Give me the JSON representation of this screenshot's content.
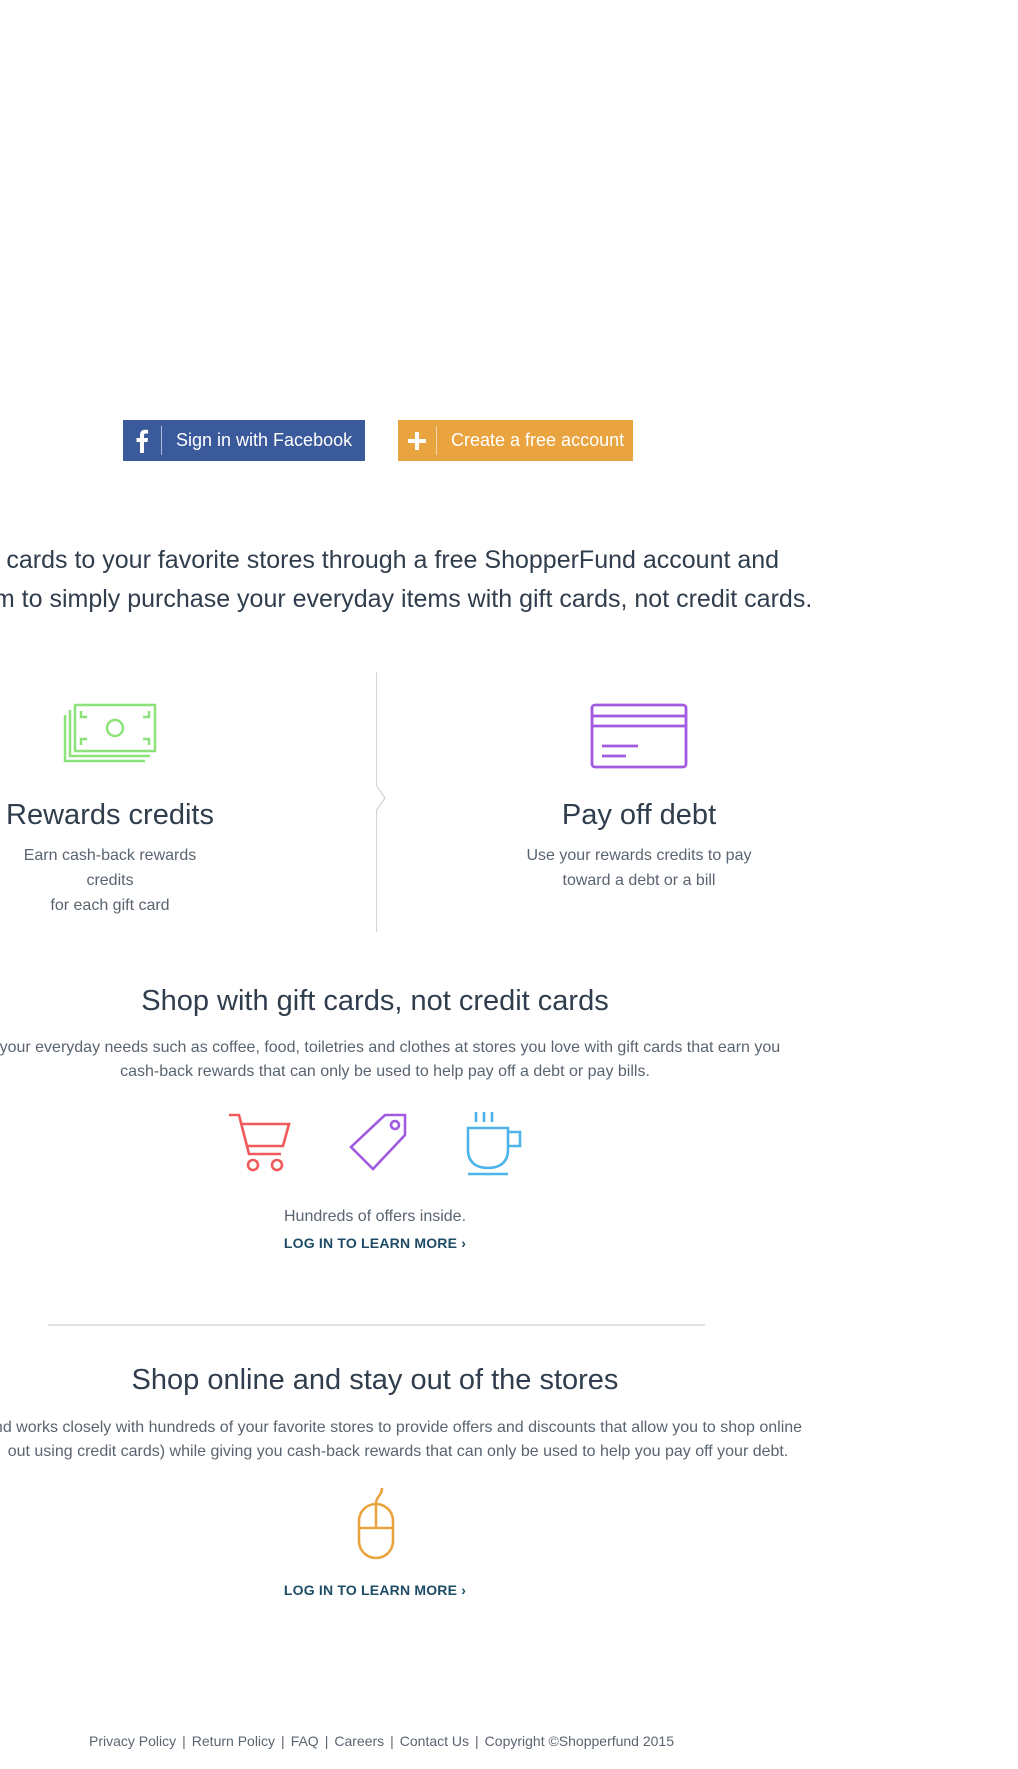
{
  "auth": {
    "facebook_label": "Sign in with Facebook",
    "create_label": "Create a free account"
  },
  "intro": {
    "line1": "ift cards to your favorite stores through a free ShopperFund account and",
    "line2": "em to simply purchase your everyday items with gift cards, not credit cards."
  },
  "features": {
    "rewards": {
      "title": "Rewards credits",
      "desc1": "Earn cash-back rewards credits",
      "desc2": "for each gift card",
      "icon": "money-stack-icon",
      "color": "#8ee27a"
    },
    "debt": {
      "title": "Pay off debt",
      "desc1": "Use your rewards credits to pay",
      "desc2": "toward a debt or a bill",
      "icon": "credit-card-icon",
      "color": "#a05be0"
    }
  },
  "giftcards": {
    "title": "Shop with gift cards, not credit cards",
    "desc1": "r your everyday needs such as coffee, food, toiletries and clothes at stores you love with gift cards that earn you",
    "desc2": "cash-back rewards that can only be used to help pay off a debt or pay bills.",
    "icons": [
      {
        "name": "shopping-cart-icon",
        "color": "#f05a5a"
      },
      {
        "name": "price-tag-icon",
        "color": "#a05be0"
      },
      {
        "name": "coffee-cup-icon",
        "color": "#4db3e8"
      }
    ],
    "offers": "Hundreds of offers inside.",
    "learn_more": "LOG IN TO LEARN MORE ›"
  },
  "online": {
    "title": "Shop online and stay out of the stores",
    "desc1": "nd works closely with hundreds of your favorite stores to provide offers and discounts that allow you to shop online",
    "desc2": "out using credit cards) while giving you cash-back rewards that can only be used to help you pay off your debt.",
    "icon": "computer-mouse-icon",
    "icon_color": "#e9a440",
    "learn_more": "LOG IN TO LEARN MORE ›"
  },
  "footer": {
    "links": [
      "Privacy Policy",
      "Return Policy",
      "FAQ",
      "Careers",
      "Contact Us"
    ],
    "copyright": "Copyright ©Shopperfund 2015"
  }
}
